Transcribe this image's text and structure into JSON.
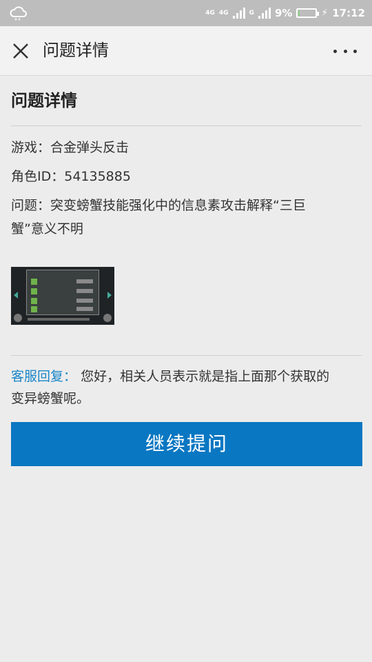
{
  "status_bar": {
    "net1": "4G",
    "net2": "4G",
    "net3": "G",
    "battery": "9%",
    "battery_level": 0.09,
    "time": "17:12"
  },
  "header": {
    "title": "问题详情",
    "close_icon": "close-icon",
    "more_icon": "more-icon"
  },
  "main": {
    "section_title": "问题详情",
    "game": "游戏：合金弹头反击",
    "role_id": "角色ID：54135885",
    "question_line1": "问题：突变螃蟹技能强化中的信息素攻击解释“三巨",
    "question_line2": "蟹”意义不明",
    "reply_label": "客服回复：",
    "reply_text_line1": "您好，相关人员表示就是指上面那个获取的",
    "reply_text_line2": "变异螃蟹呢。",
    "button_label": "继续提问"
  },
  "colors": {
    "accent": "#0a77c2",
    "reply_label": "#1a86c8",
    "status_bar": "#bdbdbd"
  }
}
